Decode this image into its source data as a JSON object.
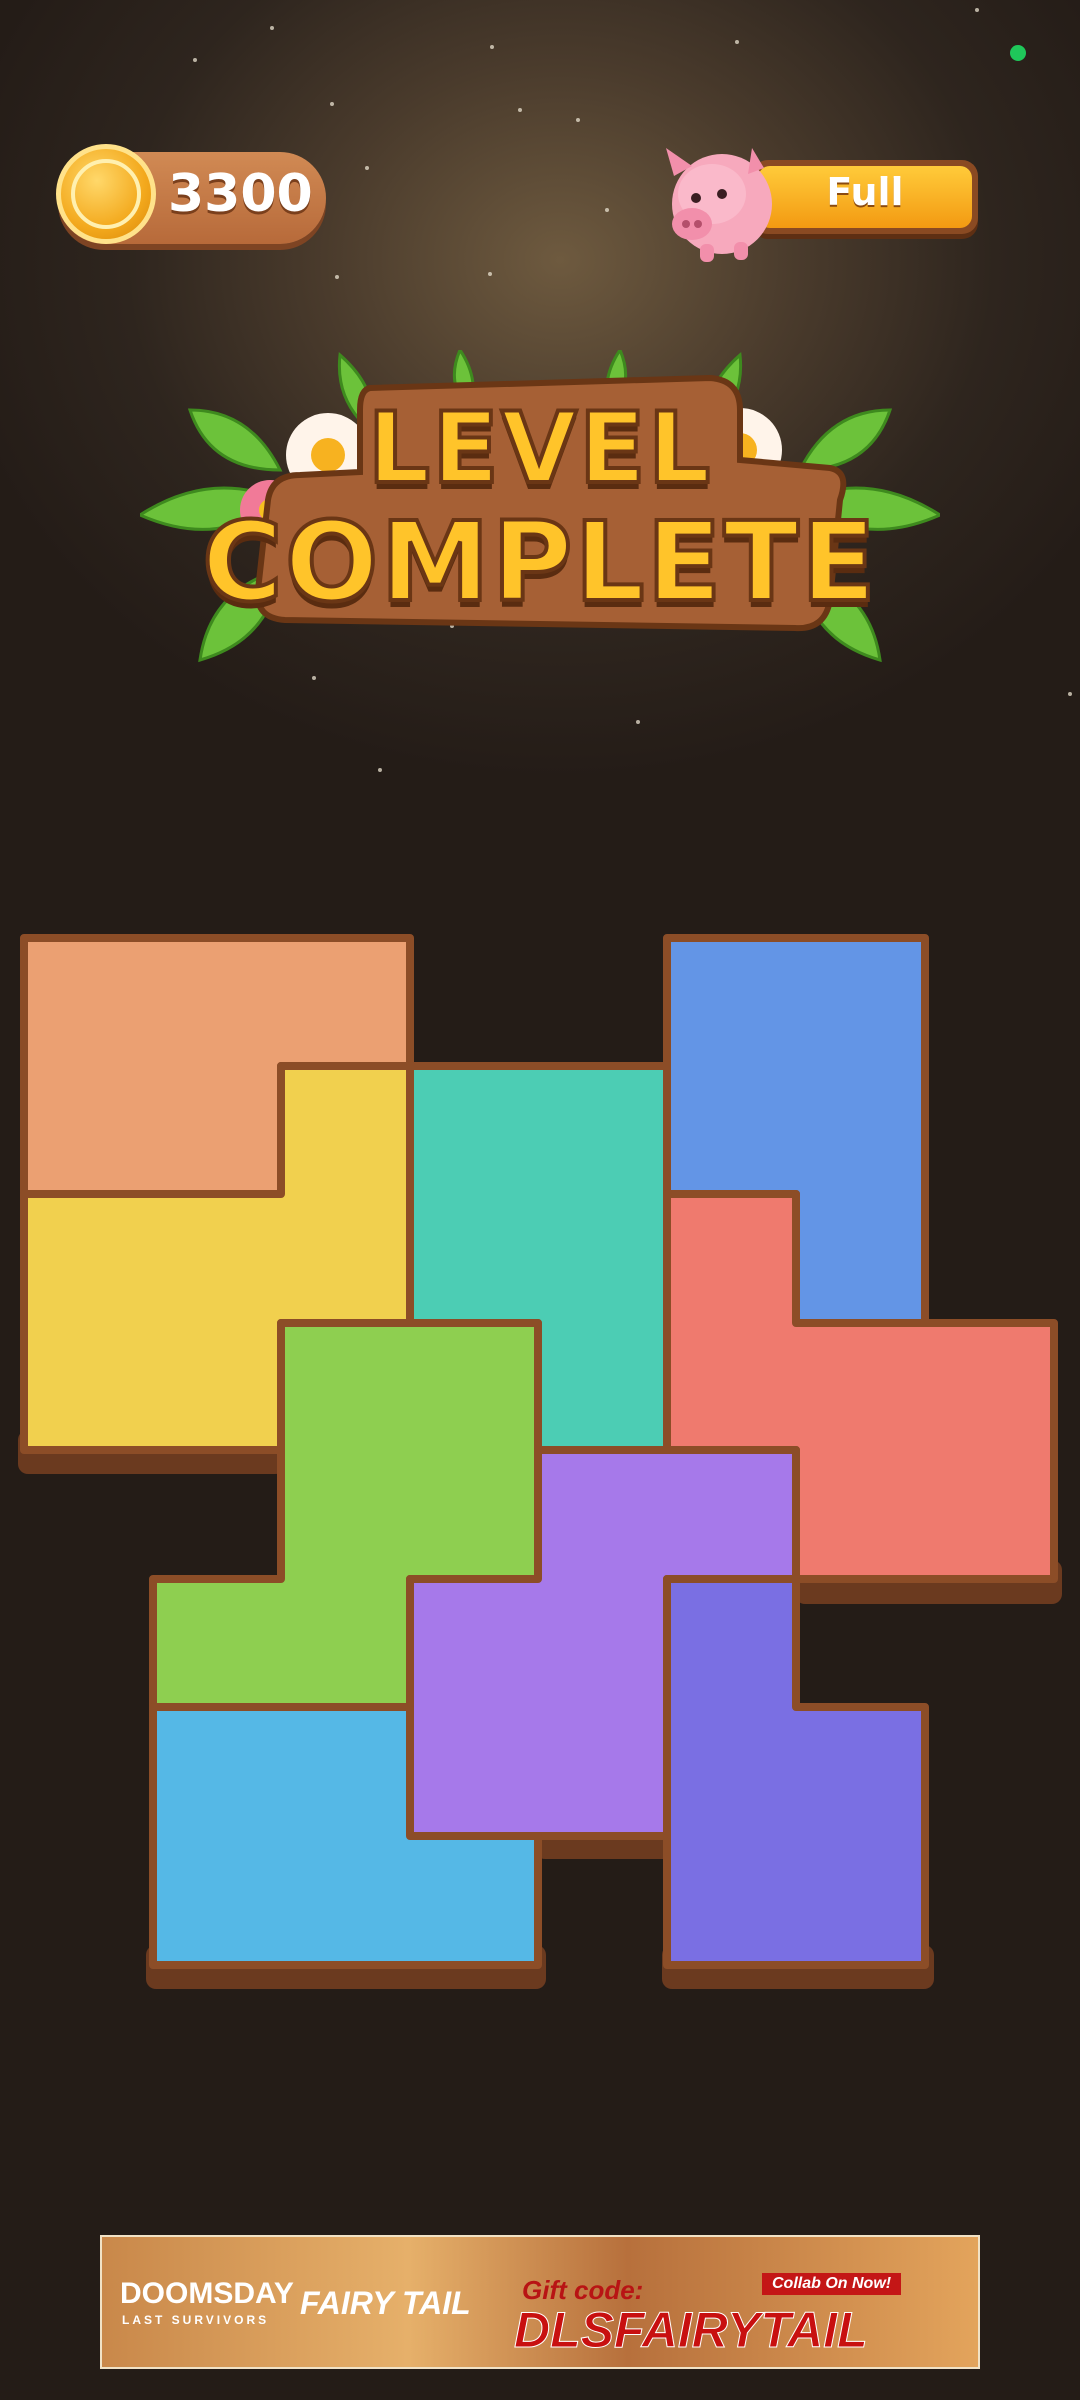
{
  "hud": {
    "coins": "3300",
    "coin_icon": "coin-shovel-icon",
    "piggy_bank_label": "Full",
    "piggy_icon": "piggy-bank-icon",
    "status_dot_color": "#1fc75a"
  },
  "banner": {
    "line1": "LEVEL",
    "line2": "COMPLETE"
  },
  "board": {
    "pieces": [
      {
        "name": "orange",
        "color": "#eba072"
      },
      {
        "name": "yellow",
        "color": "#f1d04e"
      },
      {
        "name": "teal",
        "color": "#4ccdb4"
      },
      {
        "name": "blue",
        "color": "#6395e6"
      },
      {
        "name": "red",
        "color": "#ef7a6e"
      },
      {
        "name": "green",
        "color": "#8ecf50"
      },
      {
        "name": "purple",
        "color": "#a679ea"
      },
      {
        "name": "indigo",
        "color": "#7a6fe3"
      },
      {
        "name": "sky",
        "color": "#55b8e6"
      }
    ]
  },
  "ad": {
    "brand": "DOOMSDAY",
    "brand_sub": "LAST SURVIVORS",
    "partner": "FAIRY TAIL",
    "gift_label": "Gift code:",
    "gift_code": "DLSFAIRYTAIL",
    "collab": "Collab On Now!"
  }
}
